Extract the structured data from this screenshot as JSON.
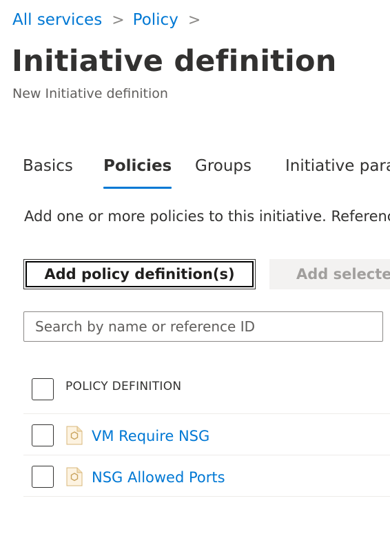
{
  "breadcrumb": {
    "items": [
      "All services",
      "Policy"
    ],
    "separator": ">"
  },
  "header": {
    "title": "Initiative definition",
    "subtitle": "New Initiative definition"
  },
  "tabs": [
    {
      "label": "Basics",
      "active": false
    },
    {
      "label": "Policies",
      "active": true
    },
    {
      "label": "Groups",
      "active": false
    },
    {
      "label": "Initiative parameters",
      "active": false
    }
  ],
  "policies_tab": {
    "description": "Add one or more policies to this initiative. Reference ID",
    "add_button_label": "Add policy definition(s)",
    "add_selected_label": "Add selected",
    "search_placeholder": "Search by name or reference ID",
    "table": {
      "column_header": "POLICY DEFINITION",
      "rows": [
        {
          "name": "VM Require NSG",
          "icon": "policy-icon"
        },
        {
          "name": "NSG Allowed Ports",
          "icon": "policy-icon"
        }
      ]
    }
  },
  "colors": {
    "accent": "#0078d4",
    "text": "#323130",
    "disabled_bg": "#f3f2f1",
    "disabled_text": "#a19f9d"
  }
}
